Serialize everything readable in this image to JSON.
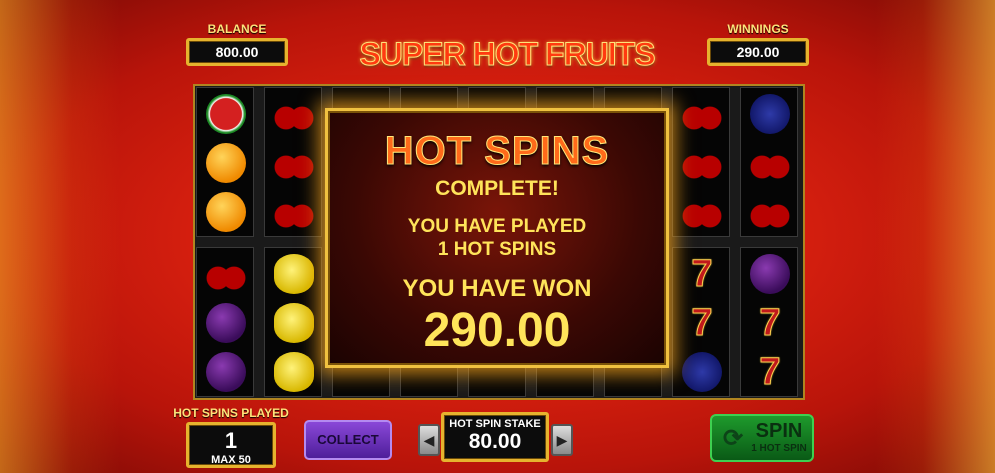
{
  "header": {
    "balance_label": "BALANCE",
    "balance_value": "800.00",
    "winnings_label": "WINNINGS",
    "winnings_value": "290.00",
    "logo_text": "SUPER HOT FRUITS"
  },
  "reels": {
    "top_row": [
      [
        "watermelon",
        "orange",
        "orange"
      ],
      [
        "cherry",
        "cherry",
        "cherry"
      ],
      [],
      [],
      [],
      [],
      [],
      [
        "cherry",
        "cherry",
        "cherry"
      ],
      [
        "grape",
        "cherry",
        "cherry"
      ]
    ],
    "bottom_row": [
      [
        "cherry",
        "plum",
        "plum"
      ],
      [
        "lemon",
        "lemon",
        "lemon"
      ],
      [],
      [],
      [],
      [],
      [],
      [
        "seven",
        "seven",
        "grape"
      ],
      [
        "plum",
        "seven",
        "seven"
      ]
    ]
  },
  "popup": {
    "title": "HOT SPINS",
    "complete": "COMPLETE!",
    "played_line1": "YOU HAVE PLAYED",
    "played_line2": "1 HOT SPINS",
    "won_label": "YOU HAVE WON",
    "won_amount": "290.00"
  },
  "footer": {
    "hot_spins_played_label": "HOT SPINS PLAYED",
    "hot_spins_played_value": "1",
    "hot_spins_played_max": "MAX 50",
    "collect_label": "COLLECT",
    "stake_label": "HOT SPIN STAKE",
    "stake_value": "80.00",
    "spin_label": "SPIN",
    "spin_sub": "1 HOT SPIN"
  },
  "colors": {
    "gold_border": "#e6b32e",
    "popup_text": "#ffe45a",
    "collect_purple": "#6a32b8",
    "spin_green": "#1e9a2c"
  }
}
